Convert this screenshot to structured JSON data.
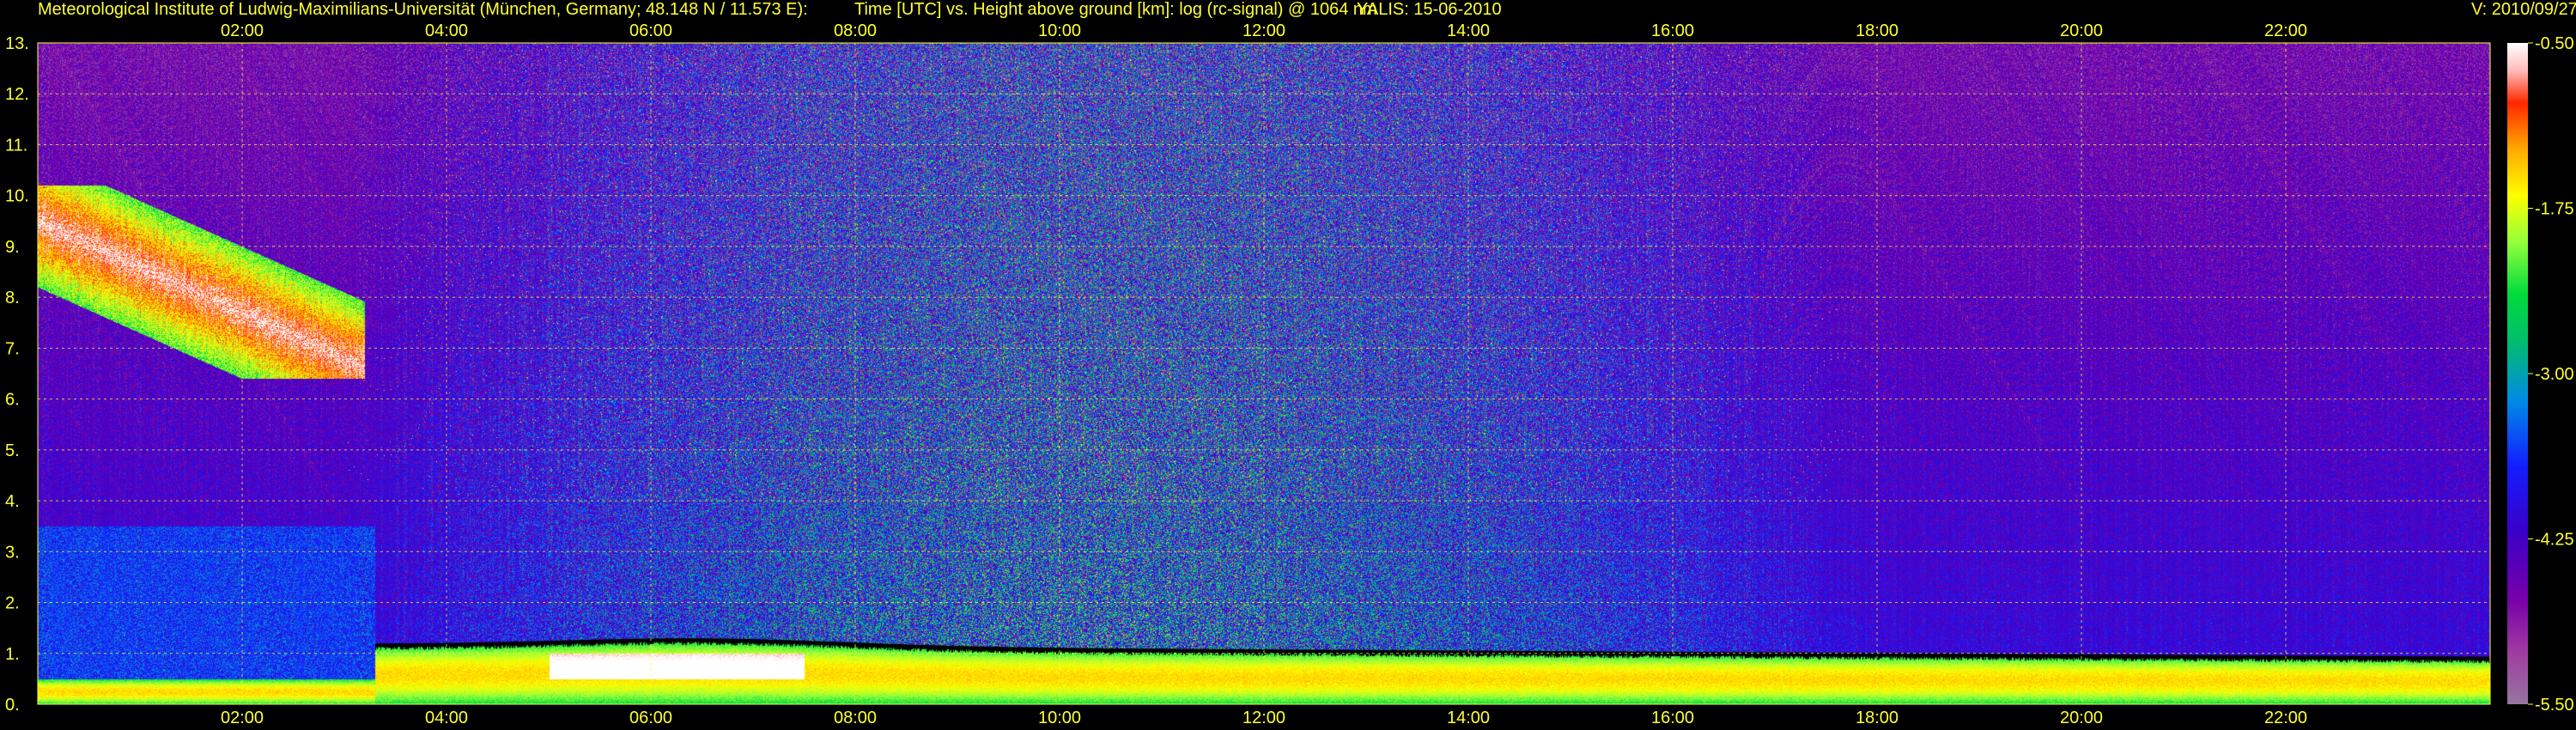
{
  "header": {
    "institute": "Meteorological Institute of Ludwig-Maximilians-Universität (München, Germany; 48.148 N / 11.573 E):",
    "description": "Time [UTC] vs. Height above ground [km]: log (rc-signal) @ 1064 nm",
    "station": "YALIS: 15-06-2010",
    "version": "V: 2010/09/27"
  },
  "chart_data": {
    "type": "heatmap",
    "title": "Time [UTC] vs. Height above ground [km]: log (rc-signal) @ 1064 nm",
    "x_tick_labels": [
      "02:00",
      "04:00",
      "06:00",
      "08:00",
      "10:00",
      "12:00",
      "14:00",
      "16:00",
      "18:00",
      "20:00",
      "22:00"
    ],
    "x_ticks_hours": [
      2,
      4,
      6,
      8,
      10,
      12,
      14,
      16,
      18,
      20,
      22
    ],
    "xlim_hours": [
      0,
      24
    ],
    "y_tick_labels": [
      "0.",
      "1.",
      "2.",
      "3.",
      "4.",
      "5.",
      "6.",
      "7.",
      "8.",
      "9.",
      "10.",
      "11.",
      "12.",
      "13."
    ],
    "ylim_km": [
      0,
      13
    ],
    "grid": true,
    "colorbar": {
      "tick_labels": [
        "-0.50",
        "-1.75",
        "-3.00",
        "-4.25",
        "-5.50"
      ],
      "range": [
        -5.5,
        -0.5
      ],
      "colors": [
        "#a48aa8",
        "#b899b8",
        "#ffffff",
        "#e0c0e0",
        "#ff0000",
        "#ff6600",
        "#ffcc00",
        "#ffff00",
        "#88ff44",
        "#00cc44",
        "#00aaaa",
        "#2266ff",
        "#1a1aff",
        "#5500cc",
        "#7700aa",
        "#993399"
      ]
    },
    "features": [
      {
        "name": "cirrus",
        "t_start": 0.1,
        "t_end": 3.2,
        "h_bottom": 6.4,
        "h_top": 10.2,
        "level": -0.6
      },
      {
        "name": "boundary-layer",
        "t_start": 3.4,
        "t_end": 23.9,
        "h_top_start": 1.2,
        "h_top_end": 1.0,
        "level": -1.5
      },
      {
        "name": "aerosol-max",
        "t_start": 5.0,
        "t_end": 7.5,
        "h_bottom": 0.5,
        "h_top": 1.0,
        "level": -0.5
      }
    ]
  }
}
